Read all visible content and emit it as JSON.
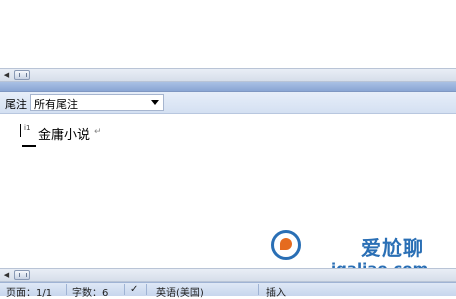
{
  "endnote_toolbar": {
    "label": "尾注",
    "selected": "所有尾注"
  },
  "note": {
    "ref": "i1",
    "text": "金庸小说",
    "para_mark": "↵"
  },
  "watermark": {
    "title": "爱尬聊",
    "subtitle": "igaliao.com"
  },
  "status_bar": {
    "page": "页面：1/1",
    "words": "字数：6",
    "language": "英语(美国)",
    "mode": "插入"
  },
  "colors": {
    "pane_bar": "#8aa6d4",
    "watermark": "#2a6fb5",
    "logo_accent": "#e56b1f"
  },
  "icons": {
    "scroll_left": "triangle-left",
    "dropdown": "triangle-down",
    "spellcheck": "check-mark"
  }
}
